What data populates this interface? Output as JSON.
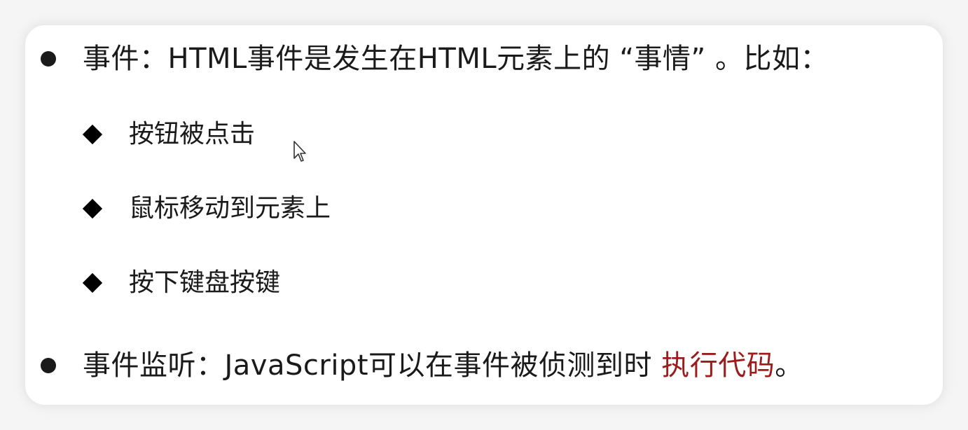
{
  "bullets": [
    {
      "text": "事件：HTML事件是发生在HTML元素上的 “事情” 。比如：",
      "subitems": [
        "按钮被点击",
        "鼠标移动到元素上",
        "按下键盘按键"
      ]
    },
    {
      "text_before": "事件监听：JavaScript可以在事件被侦测到时 ",
      "text_highlight": "执行代码",
      "text_after": "。"
    }
  ],
  "colors": {
    "highlight": "#9b1c1c",
    "text": "#1a1a1a"
  },
  "icons": {
    "bullet": "filled-circle",
    "subbullet": "filled-diamond",
    "cursor": "arrow-pointer"
  }
}
